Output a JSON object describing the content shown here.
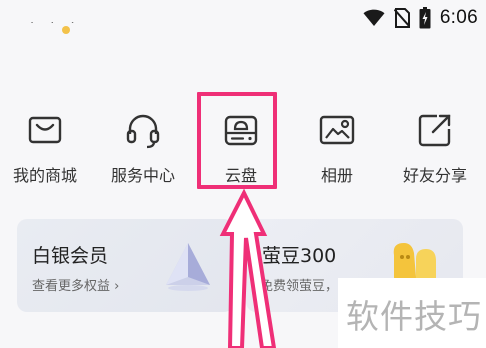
{
  "status_bar": {
    "time": "6:06",
    "icons": [
      "wifi-icon",
      "no-sim-icon",
      "battery-icon"
    ]
  },
  "menu": {
    "items": [
      {
        "label": "我的商城",
        "icon": "shop-bag-icon"
      },
      {
        "label": "服务中心",
        "icon": "headset-icon"
      },
      {
        "label": "云盘",
        "icon": "cloud-drive-icon"
      },
      {
        "label": "相册",
        "icon": "photo-album-icon"
      },
      {
        "label": "好友分享",
        "icon": "share-icon"
      }
    ]
  },
  "cards": {
    "silver": {
      "title": "白银会员",
      "subtitle": "查看更多权益 ›",
      "icon": "prism-icon"
    },
    "beans": {
      "title": "萤豆300",
      "subtitle": "免费领萤豆，",
      "icon": "bean-icon"
    }
  },
  "watermark": {
    "text": "软件技巧"
  },
  "colors": {
    "highlight": "#ef2f77",
    "background": "#f7f7f9",
    "card": "#e6e9f0",
    "bean": "#f4c43c"
  }
}
